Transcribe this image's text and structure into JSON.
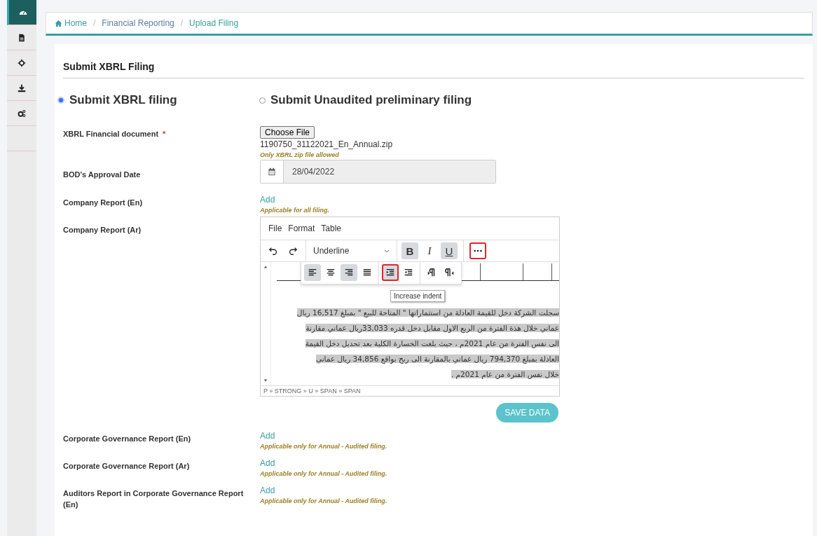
{
  "sidebar": {
    "items": [
      {
        "selected": true
      },
      {
        "selected": false
      },
      {
        "selected": false
      },
      {
        "selected": false
      },
      {
        "selected": false
      }
    ]
  },
  "breadcrumb": [
    {
      "label": "Home"
    },
    {
      "separator": "/",
      "label": "Financial Reporting"
    },
    {
      "separator": "/",
      "label": "Upload Filing"
    }
  ],
  "title": "Submit XBRL Filing",
  "filing_type": [
    {
      "label": "Submit XBRL filing",
      "selected": true
    },
    {
      "label": "Submit Unaudited preliminary filing",
      "selected": false
    }
  ],
  "fields": [
    {
      "kind": "file",
      "label": "XBRL Financial document",
      "required_mark": "*",
      "button": "Choose File",
      "value": "1190750_31122021_En_Annual.zip",
      "hint": "Only XBRL zip file allowed"
    },
    {
      "kind": "date",
      "label": "BOD's Approval Date",
      "value": "28/04/2022"
    },
    {
      "kind": "add",
      "label": "Company Report (En)",
      "link": "Add",
      "hint": "Applicable for all filing."
    },
    {
      "kind": "editor",
      "label": "Company Report (Ar)",
      "menu": [
        "File",
        "Format",
        "Table"
      ],
      "block_format": "Underline",
      "buttons": [
        {
          "kind": "text",
          "label": "B",
          "active": true,
          "highlighted": false
        },
        {
          "kind": "text",
          "label": "I",
          "active": false,
          "highlighted": false
        },
        {
          "kind": "text",
          "label": "U",
          "active": true,
          "highlighted": false
        },
        {
          "kind": "more",
          "active": false,
          "highlighted": true
        }
      ],
      "float_buttons": [
        {
          "kind": "align-left",
          "active": true,
          "highlighted": false
        },
        {
          "kind": "align-center",
          "active": false,
          "highlighted": false
        },
        {
          "kind": "align-right",
          "active": true,
          "highlighted": false
        },
        {
          "kind": "justify",
          "active": false,
          "highlighted": false
        },
        {
          "kind": "indent",
          "active": true,
          "highlighted": true
        },
        {
          "kind": "outdent",
          "active": false,
          "highlighted": false
        },
        {
          "kind": "ltr",
          "active": false,
          "highlighted": false
        },
        {
          "kind": "rtl",
          "active": false,
          "highlighted": false
        }
      ],
      "tooltip": "Increase indent",
      "lines": [
        "سجلت الشركة دخل للقيمة العادلة من استثماراتها \" المتاحة للبيع \" بمبلغ 16,517 ريال",
        "عماني خلال هذة الفترة من الربع الاول مقابل دخل قدره 33,033ريال عماني مقارنة",
        "الى نفس الفترة من عام 2021م ، حيث بلغت الخسارة الكلية بعد تحديل دخل القيمة",
        "العادلة بمبلغ 794,370 ريال عماني بالمقارنة الى ربح بواقع 34,856 ريال عماني",
        "خلال نفس الفترة من عام 2021م ."
      ],
      "path": "P » STRONG » U » SPAN » SPAN",
      "save": "SAVE DATA"
    },
    {
      "kind": "add",
      "label": "Corporate Governance Report (En)",
      "link": "Add",
      "hint": "Applicable only for Annual - Audited filing."
    },
    {
      "kind": "add",
      "label": "Corporate Governance Report (Ar)",
      "link": "Add",
      "hint": "Applicable only for Annual - Audited filing."
    },
    {
      "kind": "add",
      "label": "Auditors Report in Corporate Governance Report (En)",
      "link": "Add",
      "hint": "Applicable only for Annual - Audited filing."
    }
  ]
}
